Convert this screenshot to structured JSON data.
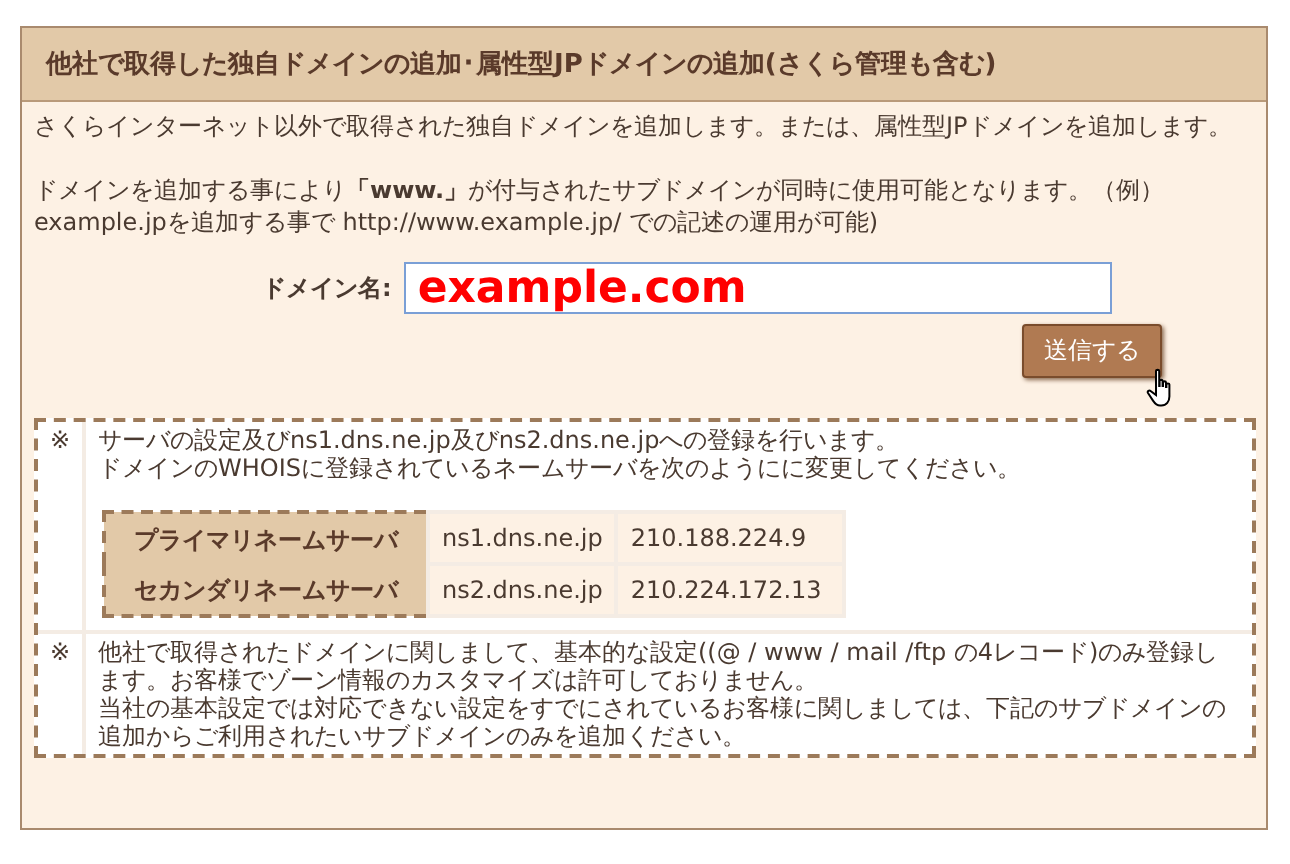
{
  "panel": {
    "title": "他社で取得した独自ドメインの追加･属性型JPドメインの追加(さくら管理も含む)",
    "intro": [
      "さくらインターネット以外で取得された独自ドメインを追加します。または、属性型JPドメインを追加します。",
      "ドメインを追加する事により**「www.」**が付与されたサブドメインが同時に使用可能となります。（例）example.jpを追加する事で http://www.example.jp/ での記述の運用が可能)"
    ],
    "form": {
      "label": "ドメイン名:",
      "value": "example.com",
      "submit": "送信する"
    },
    "notes": [
      {
        "mark": "※",
        "lines": [
          "サーバの設定及びns1.dns.ne.jp及びns2.dns.ne.jpへの登録を行います。",
          "ドメインのWHOISに登録されているネームサーバを次のようにに変更してください。"
        ],
        "servers": [
          {
            "label": "プライマリネームサーバ",
            "host": "ns1.dns.ne.jp",
            "ip": "210.188.224.9"
          },
          {
            "label": "セカンダリネームサーバ",
            "host": "ns2.dns.ne.jp",
            "ip": "210.224.172.13"
          }
        ]
      },
      {
        "mark": "※",
        "lines": [
          "他社で取得されたドメインに関しまして、基本的な設定((@ / www / mail /ftp の4レコード)のみ登録します。お客様でゾーン情報のカスタマイズは許可しておりません。",
          "当社の基本設定では対応できない設定をすでにされているお客様に関しましては、下記のサブドメインの追加からご利用されたいサブドメインのみを追加ください。"
        ]
      }
    ]
  }
}
